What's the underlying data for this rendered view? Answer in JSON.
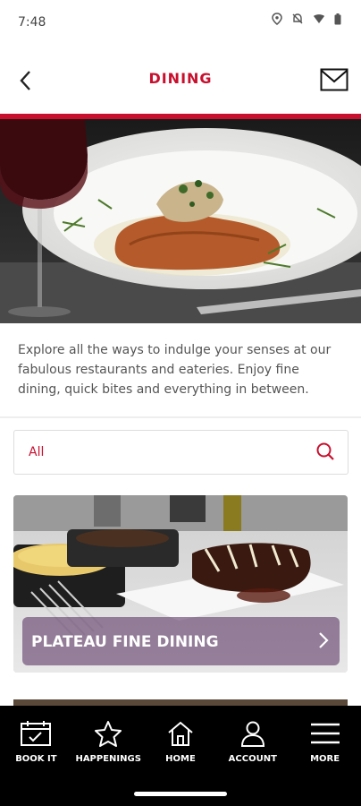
{
  "status": {
    "time": "7:48"
  },
  "header": {
    "title": "DINING"
  },
  "intro": {
    "text": "Explore all the ways to indulge your senses at our fabulous restaurants and eateries. Enjoy fine dining, quick bites and everything in between."
  },
  "filter": {
    "value": "All"
  },
  "cards": [
    {
      "label": "PLATEAU FINE DINING"
    }
  ],
  "bottom_nav": [
    {
      "label": "BOOK IT",
      "icon": "calendar-icon"
    },
    {
      "label": "HAPPENINGS",
      "icon": "star-icon"
    },
    {
      "label": "HOME",
      "icon": "home-icon"
    },
    {
      "label": "ACCOUNT",
      "icon": "account-icon"
    },
    {
      "label": "MORE",
      "icon": "menu-icon"
    }
  ],
  "colors": {
    "accent": "#c8102e",
    "nav_bg": "#000000",
    "card_overlay": "#50285a"
  }
}
